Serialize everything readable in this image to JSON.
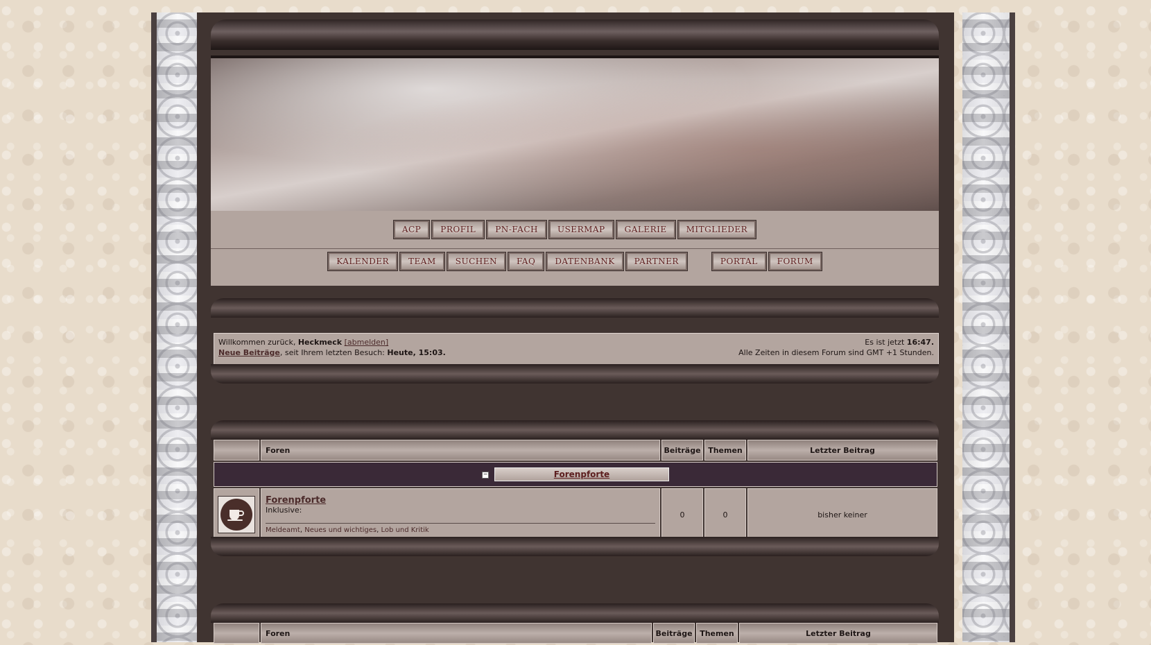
{
  "nav": {
    "row1": [
      "ACP",
      "PROFIL",
      "PN-FACH",
      "USERMAP",
      "GALERIE",
      "MITGLIEDER"
    ],
    "row2": [
      "KALENDER",
      "TEAM",
      "SUCHEN",
      "FAQ",
      "DATENBANK",
      "PARTNER"
    ],
    "row2b": [
      "PORTAL",
      "FORUM"
    ]
  },
  "welcome": {
    "prefix": "Willkommen zurück,",
    "username": "Heckmeck",
    "logout": "[abmelden]",
    "new_posts": "Neue Beiträge",
    "since_text": ", seit Ihrem letzten Besuch:",
    "last_visit": "Heute, 15:03",
    "time_prefix": "Es ist jetzt",
    "time": "16:47",
    "timezone": "Alle Zeiten in diesem Forum sind GMT +1 Stunden."
  },
  "table1": {
    "headers": {
      "foren": "Foren",
      "beitraege": "Beiträge",
      "themen": "Themen",
      "letzter": "Letzter Beitrag"
    },
    "category": "Forenpforte",
    "collapse": "−",
    "forum": {
      "title": "Forenpforte",
      "inklusive": "Inklusive:",
      "subforums": [
        "Meldeamt",
        "Neues und wichtiges",
        "Lob und Kritik"
      ],
      "posts": "0",
      "topics": "0",
      "last_post": "bisher keiner",
      "icon": "coffee-cup-icon"
    }
  },
  "table2": {
    "headers": {
      "foren": "Foren",
      "beitraege": "Beiträge",
      "themen": "Themen",
      "letzter": "Letzter Beitrag"
    }
  }
}
